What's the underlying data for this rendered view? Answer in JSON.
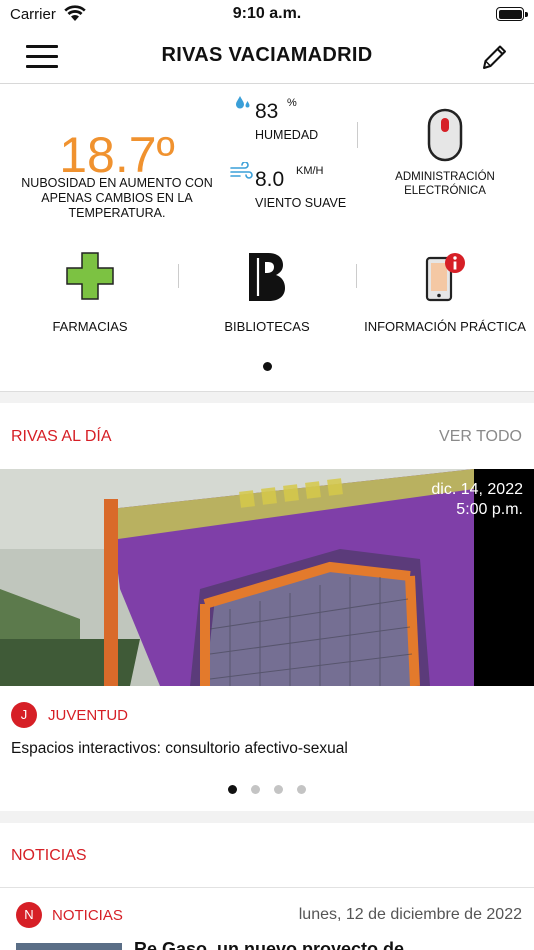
{
  "status_bar": {
    "carrier": "Carrier",
    "time": "9:10 a.m."
  },
  "header": {
    "title": "RIVAS VACIAMADRID"
  },
  "weather": {
    "temperature": "18.7º",
    "description": "Nubosidad en aumento con apenas cambios en la temperatura.",
    "humidity_value": "83",
    "humidity_unit": "%",
    "humidity_label": "HUMEDAD",
    "wind_value": "8.0",
    "wind_unit": "KM/H",
    "wind_label": "VIENTO SUAVE"
  },
  "shortcuts": {
    "admin": "ADMINISTRACIÓN ELECTRÓNICA",
    "pharmacies": "FARMACIAS",
    "libraries": "BIBLIOTECAS",
    "info": "INFORMACIÓN PRÁCTICA"
  },
  "rivas_al_dia": {
    "title": "RIVAS AL DÍA",
    "see_all": "VER TODO",
    "date": "dic. 14, 2022",
    "time": "5:00 p.m.",
    "badge": "J",
    "category": "JUVENTUD",
    "headline": "Espacios interactivos: consultorio afectivo-sexual",
    "carousel_pages": 4,
    "carousel_active": 1
  },
  "noticias": {
    "title": "NOTICIAS",
    "badge": "N",
    "category": "NOTICIAS",
    "date": "lunes, 12 de diciembre de 2022",
    "headline": "Re Gaso, un nuevo proyecto de"
  },
  "colors": {
    "accent": "#d61f26",
    "temperature": "#f0922f",
    "pharmacy": "#7cc242"
  }
}
